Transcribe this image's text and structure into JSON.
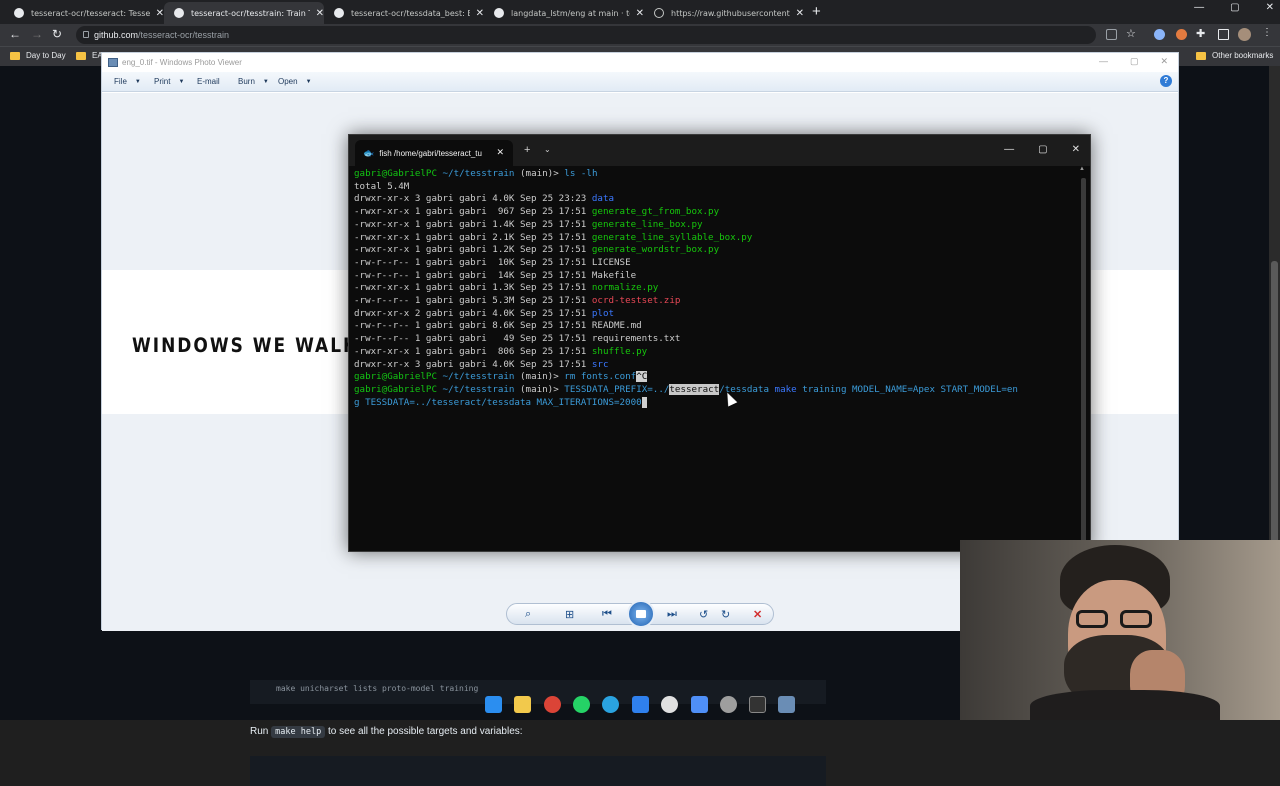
{
  "browser": {
    "tabs": [
      {
        "title": "tesseract-ocr/tesseract: Tesseract",
        "icon": "github-icon"
      },
      {
        "title": "tesseract-ocr/tesstrain: Train Tes",
        "icon": "github-icon"
      },
      {
        "title": "tesseract-ocr/tessdata_best: Best",
        "icon": "github-icon"
      },
      {
        "title": "langdata_lstm/eng at main · tess",
        "icon": "github-icon"
      },
      {
        "title": "https://raw.githubusercontent.co",
        "icon": "globe-icon"
      }
    ],
    "url_host": "github.com",
    "url_path": "/tesseract-ocr/tesstrain",
    "bookmarks": [
      "Day to Day",
      "EA"
    ],
    "other_bookmarks": "Other bookmarks"
  },
  "page": {
    "code_line": "make unicharset lists proto-model training",
    "run_prefix": "Run",
    "run_code": "make help",
    "run_suffix": "to see all the possible targets and variables:"
  },
  "photo_viewer": {
    "title": "eng_0.tif - Windows Photo Viewer",
    "menu": [
      "File",
      "Print",
      "E-mail",
      "Burn",
      "Open"
    ],
    "image_text": "WINDOWS WE WALK ABOU"
  },
  "terminal": {
    "tab_title": "fish /home/gabri/tesseract_tu",
    "prompt_user": "gabri@GabrielPC",
    "prompt_path": "~/t/tesstrain",
    "prompt_branch": "(main)>",
    "cmd1": "ls -lh",
    "total": "total 5.4M",
    "listing": [
      {
        "meta": "drwxr-xr-x 3 gabri gabri 4.0K Sep 25 23:23",
        "name": "data",
        "kind": "dir"
      },
      {
        "meta": "-rwxr-xr-x 1 gabri gabri  967 Sep 25 17:51",
        "name": "generate_gt_from_box.py",
        "kind": "exec"
      },
      {
        "meta": "-rwxr-xr-x 1 gabri gabri 1.4K Sep 25 17:51",
        "name": "generate_line_box.py",
        "kind": "exec"
      },
      {
        "meta": "-rwxr-xr-x 1 gabri gabri 2.1K Sep 25 17:51",
        "name": "generate_line_syllable_box.py",
        "kind": "exec"
      },
      {
        "meta": "-rwxr-xr-x 1 gabri gabri 1.2K Sep 25 17:51",
        "name": "generate_wordstr_box.py",
        "kind": "exec"
      },
      {
        "meta": "-rw-r--r-- 1 gabri gabri  10K Sep 25 17:51",
        "name": "LICENSE",
        "kind": "file"
      },
      {
        "meta": "-rw-r--r-- 1 gabri gabri  14K Sep 25 17:51",
        "name": "Makefile",
        "kind": "file"
      },
      {
        "meta": "-rwxr-xr-x 1 gabri gabri 1.3K Sep 25 17:51",
        "name": "normalize.py",
        "kind": "exec"
      },
      {
        "meta": "-rw-r--r-- 1 gabri gabri 5.3M Sep 25 17:51",
        "name": "ocrd-testset.zip",
        "kind": "archive"
      },
      {
        "meta": "drwxr-xr-x 2 gabri gabri 4.0K Sep 25 17:51",
        "name": "plot",
        "kind": "dir"
      },
      {
        "meta": "-rw-r--r-- 1 gabri gabri 8.6K Sep 25 17:51",
        "name": "README.md",
        "kind": "file"
      },
      {
        "meta": "-rw-r--r-- 1 gabri gabri   49 Sep 25 17:51",
        "name": "requirements.txt",
        "kind": "file"
      },
      {
        "meta": "-rwxr-xr-x 1 gabri gabri  806 Sep 25 17:51",
        "name": "shuffle.py",
        "kind": "exec"
      },
      {
        "meta": "drwxr-xr-x 3 gabri gabri 4.0K Sep 25 17:51",
        "name": "src",
        "kind": "dir"
      }
    ],
    "cmd2": "rm fonts.conf",
    "cmd2_interrupt": "^C",
    "cmd3_a": "TESSDATA_PREFIX=../",
    "cmd3_sel": "tesseract",
    "cmd3_b": "/tessdata",
    "cmd3_make": "make",
    "cmd3_c": "training MODEL_NAME=Apex START_MODEL=en",
    "cmd3_d": "g TESSDATA=../tesseract/tessdata MAX_ITERATIONS=2000",
    "colors": {
      "user": "#13c313",
      "path": "#3b9bd8",
      "exec": "#16c60c",
      "dir": "#3b78ff",
      "archive": "#e74856"
    }
  }
}
